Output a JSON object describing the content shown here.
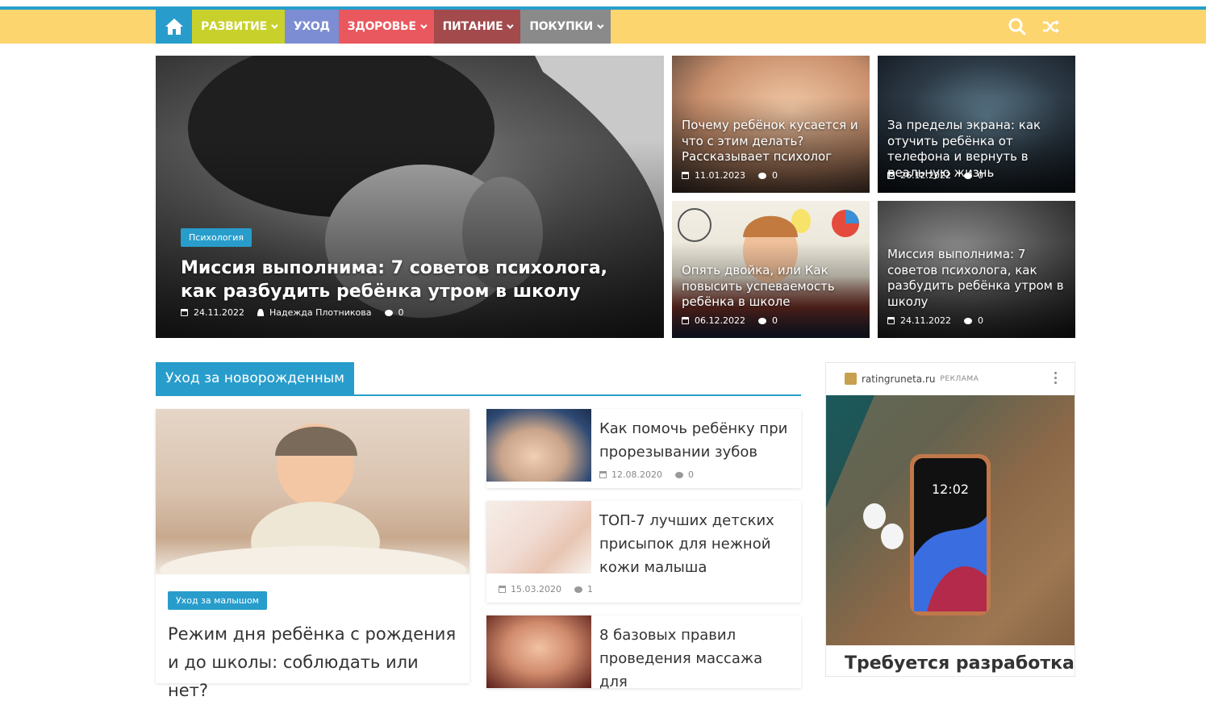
{
  "nav": {
    "items": [
      {
        "label": "РАЗВИТИЕ",
        "color": "#c8d12b",
        "dropdown": true
      },
      {
        "label": "УХОД",
        "color": "#7d8dd3",
        "dropdown": false
      },
      {
        "label": "ЗДОРОВЬЕ",
        "color": "#e9585e",
        "dropdown": true
      },
      {
        "label": "ПИТАНИЕ",
        "color": "#a24a4c",
        "dropdown": true
      },
      {
        "label": "ПОКУПКИ",
        "color": "#8a8a8a",
        "dropdown": true
      }
    ]
  },
  "featured": {
    "main": {
      "tag": "Психология",
      "title": "Миссия выполнима: 7 советов психолога, как разбудить ребёнка утром в школу",
      "date": "24.11.2022",
      "author": "Надежда Плотникова",
      "comments": "0"
    },
    "tiles": [
      {
        "title": "Почему ребёнок кусается и что с этим делать? Рассказывает психолог",
        "date": "11.01.2023",
        "comments": "0"
      },
      {
        "title": "За пределы экрана: как отучить ребёнка от телефона и вернуть в реальную жизнь",
        "date": "26.12.2022",
        "comments": "0"
      },
      {
        "title": "Опять двойка, или Как повысить успеваемость ребёнка в школе",
        "date": "06.12.2022",
        "comments": "0"
      },
      {
        "title": "Миссия выполнима: 7 советов психолога, как разбудить ребёнка утром в школу",
        "date": "24.11.2022",
        "comments": "0"
      }
    ]
  },
  "section": {
    "title": "Уход за новорожденным",
    "big_card": {
      "tag": "Уход за малышом",
      "title": "Режим дня ребёнка с рождения и до школы: соблюдать или нет?"
    },
    "small_cards": [
      {
        "title": "Как помочь ребёнку при прорезывании зубов",
        "date": "12.08.2020",
        "comments": "0"
      },
      {
        "title": "ТОП-7 лучших детских присыпок для нежной кожи малыша",
        "date": "15.03.2020",
        "comments": "1"
      },
      {
        "title": "8 базовых правил проведения массажа для",
        "date": "",
        "comments": ""
      }
    ]
  },
  "ad": {
    "domain": "ratingruneta.ru",
    "label": "РЕКЛАМА",
    "phone_time": "12:02",
    "headline": "Требуется разработка"
  },
  "colors": {
    "accent": "#289dcc",
    "navbar": "#fdd56f"
  }
}
